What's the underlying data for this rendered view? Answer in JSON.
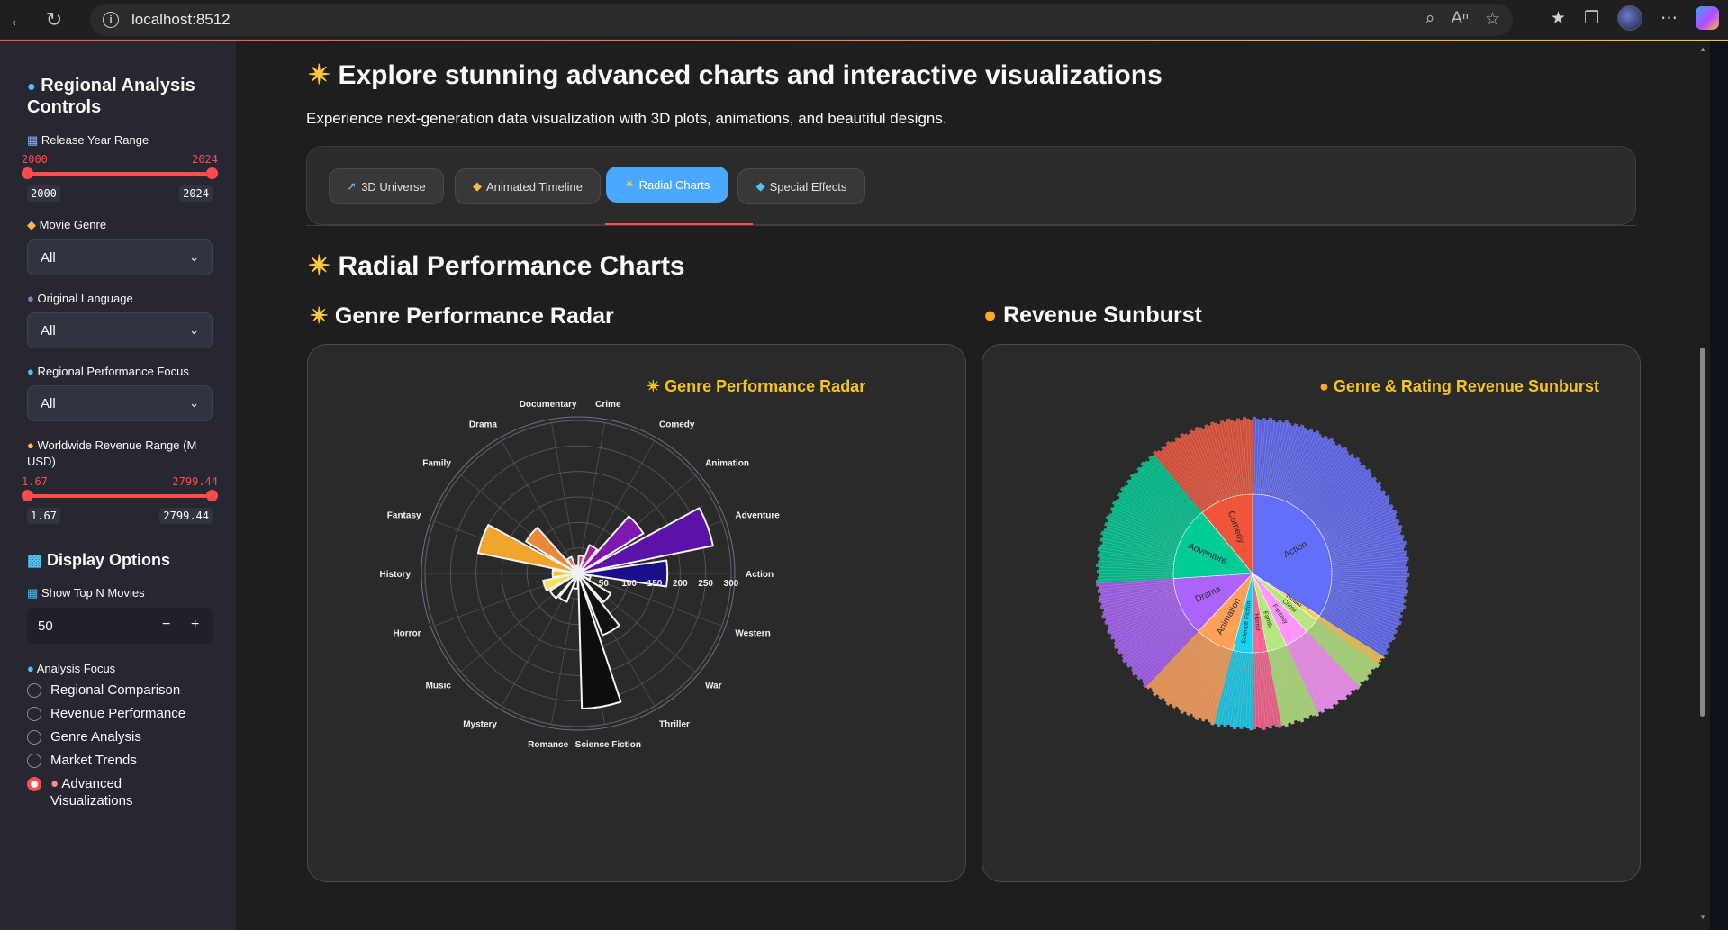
{
  "browser": {
    "url": "localhost:8512"
  },
  "sidebar": {
    "title_icon": "globe-icon",
    "title": "Regional Analysis Controls",
    "release_year": {
      "label": "Release Year Range",
      "low": "2000",
      "high": "2024",
      "min": "2000",
      "max": "2024"
    },
    "genre": {
      "label": "Movie Genre",
      "value": "All"
    },
    "language": {
      "label": "Original Language",
      "value": "All"
    },
    "region": {
      "label": "Regional Performance Focus",
      "value": "All"
    },
    "revenue": {
      "label": "Worldwide Revenue Range (M USD)",
      "low": "1.67",
      "high": "2799.44",
      "min": "1.67",
      "max": "2799.44"
    },
    "display_title": "Display Options",
    "top_n": {
      "label": "Show Top N Movies",
      "value": "50",
      "minus": "−",
      "plus": "+"
    },
    "analysis_focus": {
      "label": "Analysis Focus",
      "options": [
        "Regional Comparison",
        "Revenue Performance",
        "Genre Analysis",
        "Market Trends",
        "Advanced Visualizations"
      ],
      "selected": "Advanced Visualizations"
    }
  },
  "main": {
    "title": "Explore stunning advanced charts and interactive visualizations",
    "subtitle": "Experience next-generation data visualization with 3D plots, animations, and beautiful designs.",
    "tabs": [
      {
        "label": "3D Universe",
        "icon": "rocket-icon"
      },
      {
        "label": "Animated Timeline",
        "icon": "theater-icon"
      },
      {
        "label": "Radial Charts",
        "icon": "sun-icon"
      },
      {
        "label": "Special Effects",
        "icon": "gem-icon"
      }
    ],
    "active_tab": "Radial Charts",
    "section_title": "Radial Performance Charts",
    "left_title": "Genre Performance Radar",
    "right_title": "Revenue Sunburst",
    "left_chart_title": "Genre Performance Radar",
    "right_chart_title": "Genre & Rating Revenue Sunburst"
  },
  "colors": {
    "accent": "#ff4b4b",
    "active_tab": "#4aa8ff",
    "chart_title": "#f5c518"
  },
  "chart_data": [
    {
      "type": "bar",
      "subtype": "polar",
      "title": "Genre Performance Radar",
      "categories": [
        "Action",
        "Adventure",
        "Animation",
        "Comedy",
        "Crime",
        "Documentary",
        "Drama",
        "Family",
        "Fantasy",
        "History",
        "Horror",
        "Music",
        "Mystery",
        "Romance",
        "Science Fiction",
        "Thriller",
        "War",
        "Western"
      ],
      "values": [
        175,
        270,
        150,
        60,
        35,
        15,
        35,
        120,
        200,
        50,
        70,
        65,
        60,
        30,
        265,
        130,
        75,
        25
      ],
      "radial_ticks": [
        "50",
        "100",
        "150",
        "200",
        "250",
        "300"
      ],
      "rlim": [
        0,
        300
      ]
    },
    {
      "type": "sunburst",
      "title": "Genre & Rating Revenue Sunburst",
      "inner_ring": [
        {
          "name": "Action",
          "share": 0.34,
          "color": "#636efa"
        },
        {
          "name": "Thriller",
          "share": 0.01,
          "color": "#fecb52"
        },
        {
          "name": "Crime",
          "share": 0.03,
          "color": "#b6e880"
        },
        {
          "name": "Fantasy",
          "share": 0.05,
          "color": "#ff97ff"
        },
        {
          "name": "Family",
          "share": 0.04,
          "color": "#b6e880"
        },
        {
          "name": "Horror",
          "share": 0.03,
          "color": "#ff6692"
        },
        {
          "name": "Science Fiction",
          "share": 0.04,
          "color": "#19d3f3"
        },
        {
          "name": "Animation",
          "share": 0.08,
          "color": "#ffa15a"
        },
        {
          "name": "Drama",
          "share": 0.12,
          "color": "#ab63fa"
        },
        {
          "name": "Adventure",
          "share": 0.15,
          "color": "#00cc96"
        },
        {
          "name": "Comedy",
          "share": 0.11,
          "color": "#ef553b"
        }
      ]
    }
  ]
}
